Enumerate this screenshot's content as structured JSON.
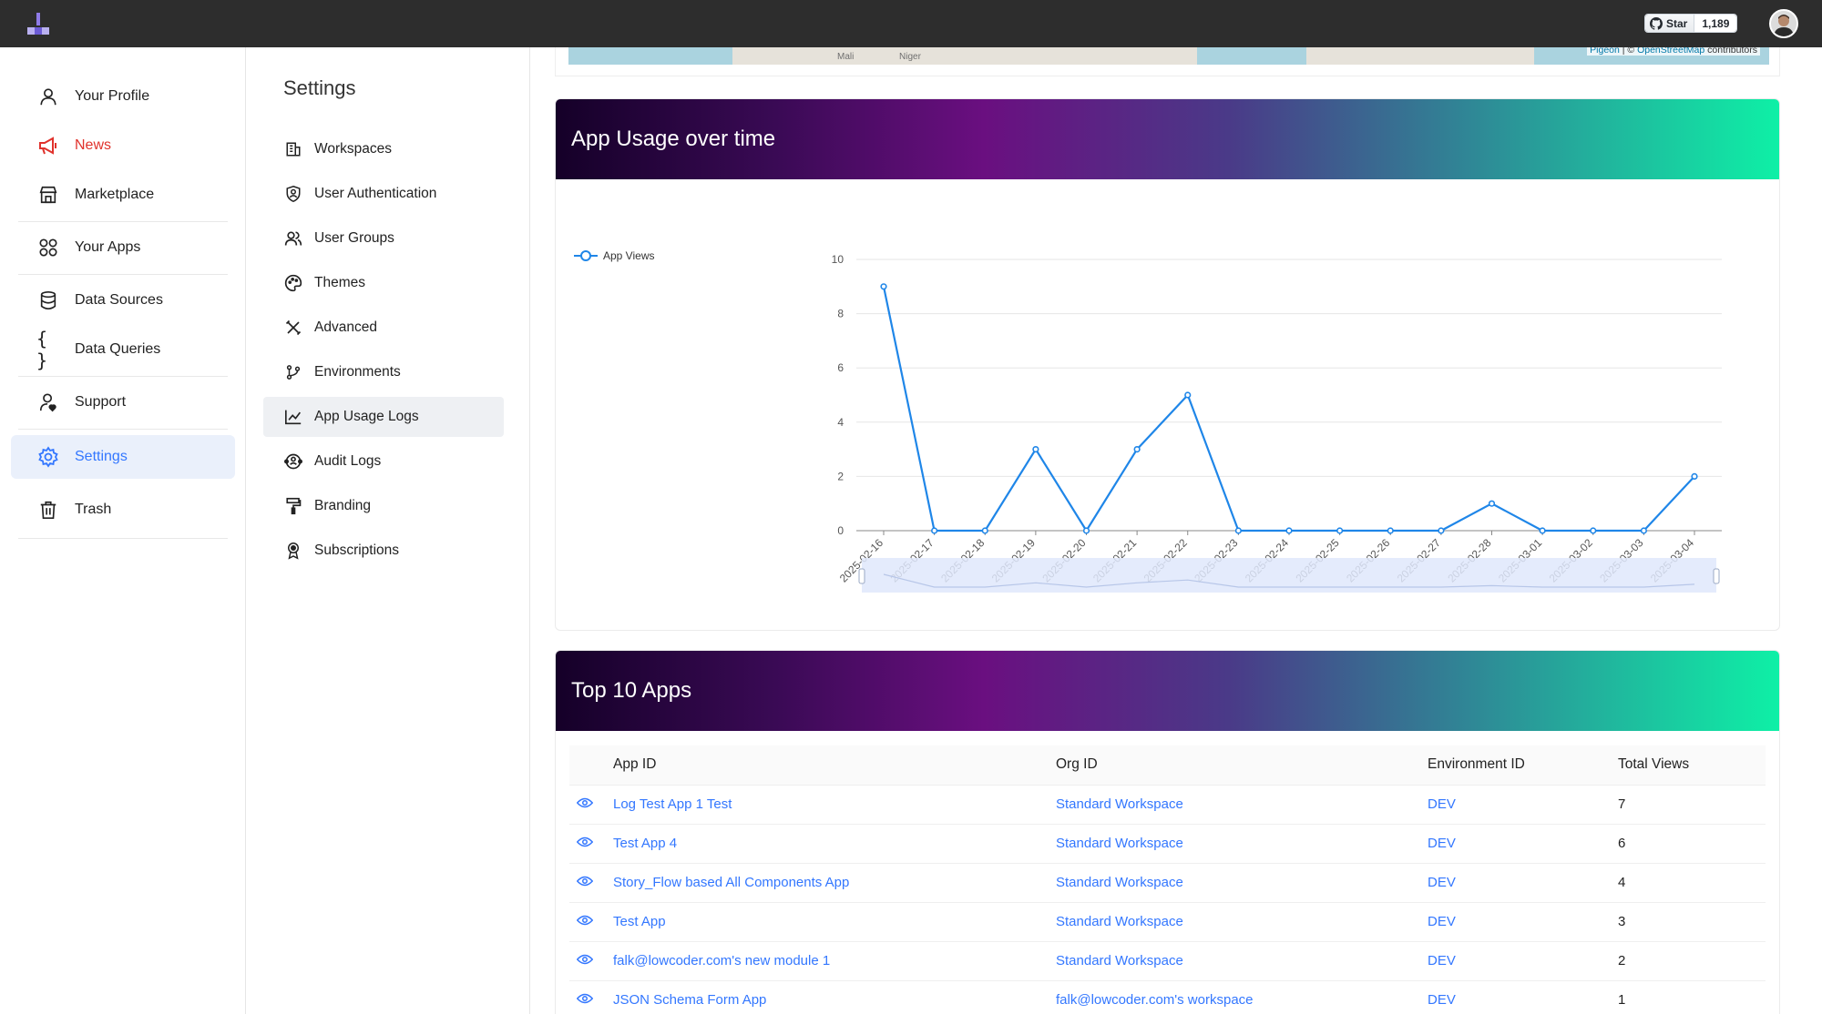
{
  "topbar": {
    "github": {
      "star_label": "Star",
      "star_count": "1,189"
    }
  },
  "left_nav": {
    "items": [
      {
        "label": "Your Profile",
        "icon": "user-icon"
      },
      {
        "label": "News",
        "icon": "megaphone-icon"
      },
      {
        "label": "Marketplace",
        "icon": "store-icon"
      },
      {
        "label": "Your Apps",
        "icon": "apps-grid-icon"
      },
      {
        "label": "Data Sources",
        "icon": "database-icon"
      },
      {
        "label": "Data Queries",
        "icon": "braces-icon"
      },
      {
        "label": "Support",
        "icon": "support-user-icon"
      },
      {
        "label": "Settings",
        "icon": "gear-icon"
      },
      {
        "label": "Trash",
        "icon": "trash-icon"
      }
    ],
    "active": "Settings",
    "accent_color": "#3377ff",
    "news_color": "#e0322c"
  },
  "settings_nav": {
    "title": "Settings",
    "items": [
      {
        "label": "Workspaces",
        "icon": "building-icon"
      },
      {
        "label": "User Authentication",
        "icon": "shield-icon"
      },
      {
        "label": "User Groups",
        "icon": "users-icon"
      },
      {
        "label": "Themes",
        "icon": "palette-icon"
      },
      {
        "label": "Advanced",
        "icon": "tools-icon"
      },
      {
        "label": "Environments",
        "icon": "branch-icon"
      },
      {
        "label": "App Usage Logs",
        "icon": "line-chart-icon"
      },
      {
        "label": "Audit Logs",
        "icon": "audit-icon"
      },
      {
        "label": "Branding",
        "icon": "paint-roller-icon"
      },
      {
        "label": "Subscriptions",
        "icon": "award-icon"
      }
    ],
    "active": "App Usage Logs"
  },
  "map": {
    "labels": [
      "Mali",
      "Niger"
    ],
    "attribution": {
      "pigeon": "Pigeon",
      "separator": " | © ",
      "osm": "OpenStreetMap",
      "suffix": " contributors"
    }
  },
  "usage_card": {
    "title": "App Usage over time"
  },
  "chart_data": {
    "type": "line",
    "title": "App Usage over time",
    "legend_position": "top-left",
    "grid": true,
    "ylim": [
      0,
      10
    ],
    "yticks": [
      0,
      2,
      4,
      6,
      8,
      10
    ],
    "categories": [
      "2025-02-16",
      "2025-02-17",
      "2025-02-18",
      "2025-02-19",
      "2025-02-20",
      "2025-02-21",
      "2025-02-22",
      "2025-02-23",
      "2025-02-24",
      "2025-02-25",
      "2025-02-26",
      "2025-02-27",
      "2025-02-28",
      "2025-03-01",
      "2025-03-02",
      "2025-03-03",
      "2025-03-04"
    ],
    "series": [
      {
        "name": "App Views",
        "color": "#1f86e8",
        "values": [
          9,
          0,
          0,
          3,
          0,
          3,
          5,
          0,
          0,
          0,
          0,
          0,
          1,
          0,
          0,
          0,
          2
        ]
      }
    ]
  },
  "top_apps": {
    "title": "Top 10 Apps",
    "columns": [
      "App ID",
      "Org ID",
      "Environment ID",
      "Total Views"
    ],
    "rows": [
      {
        "app": "Log Test App 1 Test",
        "org": "Standard Workspace",
        "env": "DEV",
        "views": "7"
      },
      {
        "app": "Test App 4",
        "org": "Standard Workspace",
        "env": "DEV",
        "views": "6"
      },
      {
        "app": "Story_Flow based All Components App",
        "org": "Standard Workspace",
        "env": "DEV",
        "views": "4"
      },
      {
        "app": "Test App",
        "org": "Standard Workspace",
        "env": "DEV",
        "views": "3"
      },
      {
        "app": "falk@lowcoder.com's new module 1",
        "org": "Standard Workspace",
        "env": "DEV",
        "views": "2"
      },
      {
        "app": "JSON Schema Form App",
        "org": "falk@lowcoder.com's workspace",
        "env": "DEV",
        "views": "1"
      }
    ]
  }
}
